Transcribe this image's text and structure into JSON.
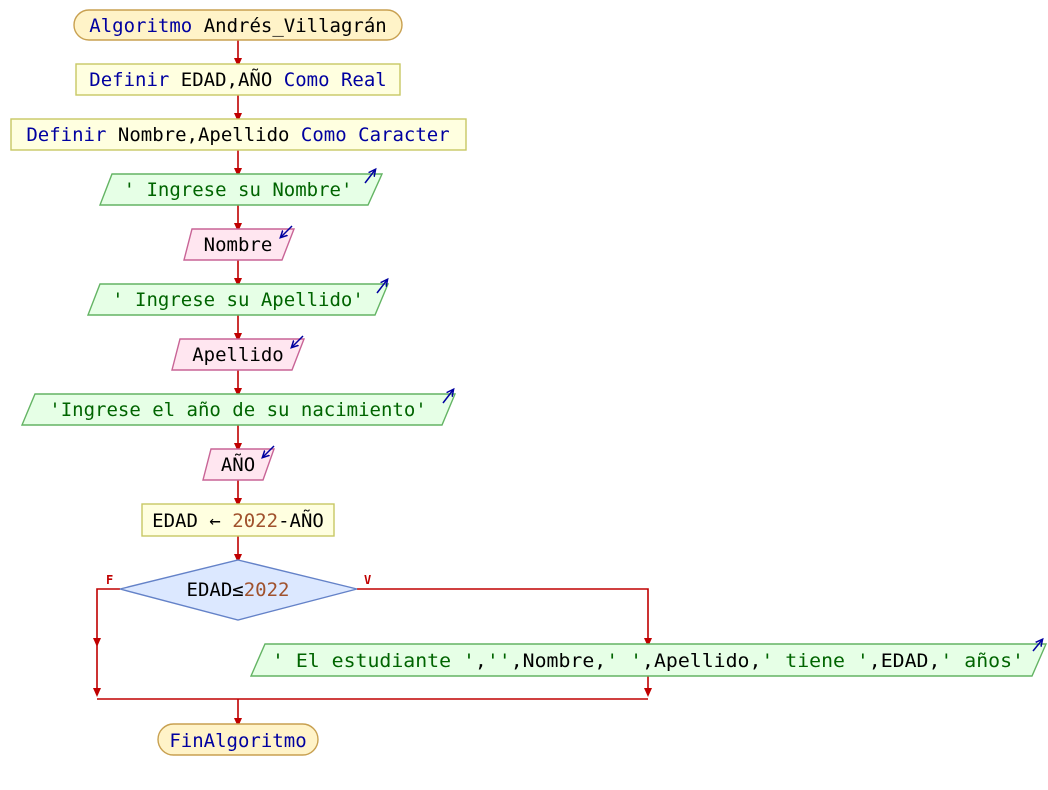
{
  "colors": {
    "line": "#c00000",
    "keyword": "#0000a0",
    "text": "#000000",
    "string": "#006400",
    "number": "#a0522d",
    "terminal_fill": "#fff3c8",
    "terminal_stroke": "#c8a050",
    "process_fill": "#ffffe0",
    "process_stroke": "#c8c864",
    "output_fill": "#e6ffe6",
    "output_stroke": "#64b464",
    "input_fill": "#ffe6f0",
    "input_stroke": "#c86496",
    "decision_fill": "#dce8ff",
    "decision_stroke": "#6482c8",
    "io_arrow": "#0000a0",
    "branch_label": "#c00000"
  },
  "flowchart": {
    "start": {
      "keyword": "Algoritmo",
      "name": "Andrés_Villagrán"
    },
    "define_1": {
      "kw1": "Definir",
      "vars": "EDAD,AÑO",
      "kw2": "Como",
      "type": "Real"
    },
    "define_2": {
      "kw1": "Definir",
      "vars": "Nombre,Apellido",
      "kw2": "Como",
      "type": "Caracter"
    },
    "output_1": {
      "text": "' Ingrese su Nombre'"
    },
    "input_1": {
      "var": "Nombre"
    },
    "output_2": {
      "text": "' Ingrese su Apellido'"
    },
    "input_2": {
      "var": "Apellido"
    },
    "output_3": {
      "text": "'Ingrese el año de su nacimiento'"
    },
    "input_3": {
      "var": "AÑO"
    },
    "assign": {
      "target": "EDAD",
      "arrow": "←",
      "number": "2022",
      "rest": "-AÑO"
    },
    "decision": {
      "var": "EDAD",
      "op": "≤",
      "number": "2022",
      "false_label": "F",
      "true_label": "V"
    },
    "output_4": {
      "s1": "' El estudiante '",
      "c1": ",",
      "s2": "''",
      "c2": ",Nombre,",
      "s3": "' '",
      "c3": ",Apellido,",
      "s4": "' tiene '",
      "c4": ",EDAD,",
      "s5": "' años'"
    },
    "end": {
      "keyword": "FinAlgoritmo"
    }
  }
}
